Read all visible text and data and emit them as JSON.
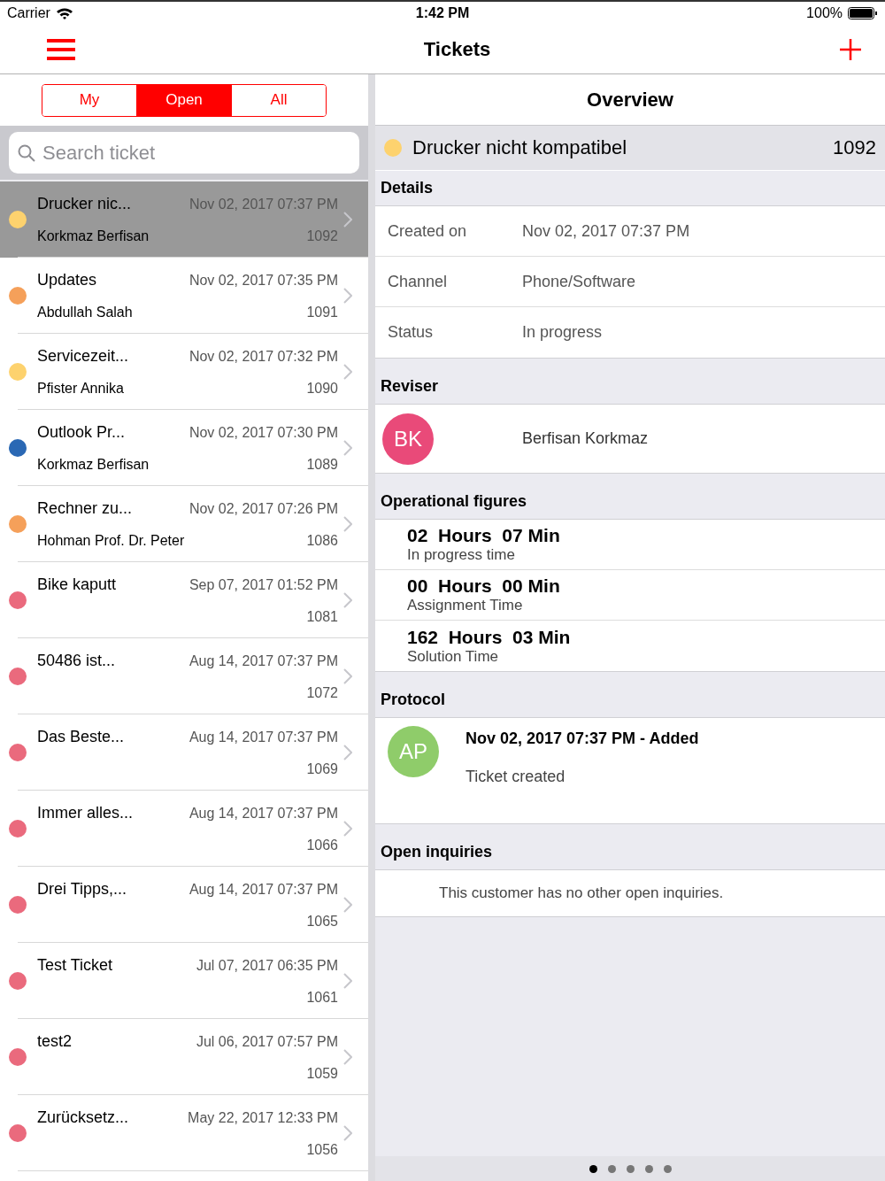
{
  "status_bar": {
    "carrier": "Carrier",
    "time": "1:42 PM",
    "battery": "100%"
  },
  "nav": {
    "title": "Tickets"
  },
  "segments": [
    {
      "label": "My",
      "selected": false
    },
    {
      "label": "Open",
      "selected": true
    },
    {
      "label": "All",
      "selected": false
    }
  ],
  "search": {
    "placeholder": "Search ticket"
  },
  "tickets": [
    {
      "title": "Drucker nic...",
      "date": "Nov 02, 2017 07:37 PM",
      "customer": "Korkmaz Berfisan",
      "number": "1092",
      "color": "#fdd26e",
      "selected": true
    },
    {
      "title": "Updates",
      "date": "Nov 02, 2017 07:35 PM",
      "customer": "Abdullah Salah",
      "number": "1091",
      "color": "#f5a05a",
      "selected": false
    },
    {
      "title": "Servicezeit...",
      "date": "Nov 02, 2017 07:32 PM",
      "customer": "Pfister Annika",
      "number": "1090",
      "color": "#fdd26e",
      "selected": false
    },
    {
      "title": "Outlook Pr...",
      "date": "Nov 02, 2017 07:30 PM",
      "customer": "Korkmaz Berfisan",
      "number": "1089",
      "color": "#2a68b4",
      "selected": false
    },
    {
      "title": "Rechner zu...",
      "date": "Nov 02, 2017 07:26 PM",
      "customer": "Hohman Prof. Dr. Peter",
      "number": "1086",
      "color": "#f5a05a",
      "selected": false
    },
    {
      "title": "Bike kaputt",
      "date": "Sep 07, 2017 01:52 PM",
      "number": "1081",
      "color": "#ea6a7d",
      "selected": false
    },
    {
      "title": "50486 ist...",
      "date": "Aug 14, 2017 07:37 PM",
      "number": "1072",
      "color": "#ea6a7d",
      "selected": false
    },
    {
      "title": "Das Beste...",
      "date": "Aug 14, 2017 07:37 PM",
      "number": "1069",
      "color": "#ea6a7d",
      "selected": false
    },
    {
      "title": "Immer alles...",
      "date": "Aug 14, 2017 07:37 PM",
      "number": "1066",
      "color": "#ea6a7d",
      "selected": false
    },
    {
      "title": "Drei Tipps,...",
      "date": "Aug 14, 2017 07:37 PM",
      "number": "1065",
      "color": "#ea6a7d",
      "selected": false
    },
    {
      "title": "Test Ticket",
      "date": "Jul 07, 2017 06:35 PM",
      "number": "1061",
      "color": "#ea6a7d",
      "selected": false
    },
    {
      "title": "test2",
      "date": "Jul 06, 2017 07:57 PM",
      "number": "1059",
      "color": "#ea6a7d",
      "selected": false
    },
    {
      "title": "Zurücksetz...",
      "date": "May 22, 2017 12:33 PM",
      "number": "1056",
      "color": "#ea6a7d",
      "selected": false
    }
  ],
  "detail": {
    "heading": "Overview",
    "ticket": {
      "title": "Drucker nicht kompatibel",
      "number": "1092",
      "color": "#fdd26e"
    },
    "details": {
      "header": "Details",
      "rows": [
        {
          "label": "Created on",
          "value": "Nov 02, 2017 07:37 PM"
        },
        {
          "label": "Channel",
          "value": "Phone/Software"
        },
        {
          "label": "Status",
          "value": "In progress"
        }
      ]
    },
    "reviser": {
      "header": "Reviser",
      "initials": "BK",
      "color": "#e94a79",
      "name": "Berfisan Korkmaz"
    },
    "figures": {
      "header": "Operational figures",
      "items": [
        {
          "value": "02  Hours  07 Min",
          "label": "In progress time"
        },
        {
          "value": "00  Hours  00 Min",
          "label": "Assignment Time"
        },
        {
          "value": "162  Hours  03 Min",
          "label": "Solution Time"
        }
      ]
    },
    "protocol": {
      "header": "Protocol",
      "entries": [
        {
          "initials": "AP",
          "color": "#8fcc6a",
          "title": "Nov 02, 2017 07:37 PM - Added",
          "text": "Ticket created"
        }
      ]
    },
    "inquiries": {
      "header": "Open inquiries",
      "text": "This customer has no other open inquiries."
    }
  },
  "page_dots": [
    {
      "selected": true
    },
    {
      "selected": false
    },
    {
      "selected": false
    },
    {
      "selected": false
    },
    {
      "selected": false
    }
  ]
}
